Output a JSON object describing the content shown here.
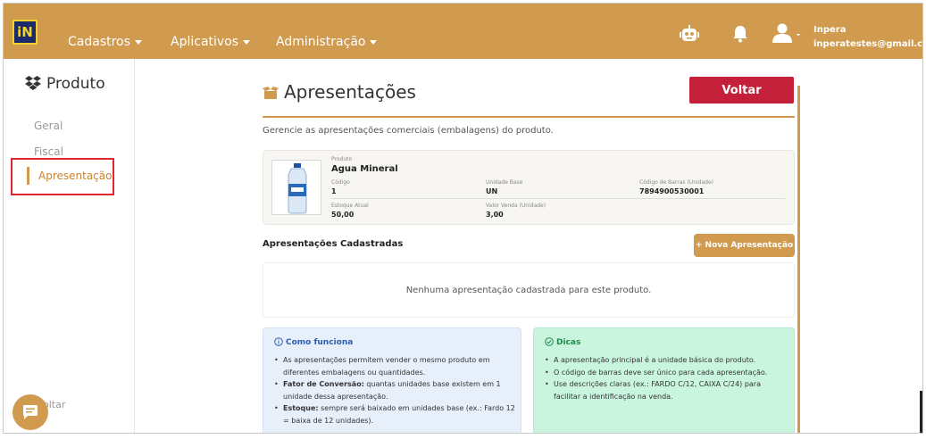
{
  "app": {
    "logo_text": "iN"
  },
  "nav": {
    "items": [
      {
        "label": "Cadastros"
      },
      {
        "label": "Aplicativos"
      },
      {
        "label": "Administração"
      }
    ]
  },
  "user": {
    "name": "Inpera",
    "email": "inperatestes@gmail.com"
  },
  "sidebar": {
    "title": "Produto",
    "items": [
      {
        "label": "Geral"
      },
      {
        "label": "Fiscal"
      },
      {
        "label": "Apresentação"
      }
    ],
    "bottom_label": "oltar"
  },
  "main": {
    "title": "Apresentações",
    "back_button": "Voltar",
    "subtitle": "Gerencie as apresentações comerciais (embalagens) do produto.",
    "product": {
      "label_produto": "Produto",
      "nome": "Agua Mineral",
      "label_codigo": "Código",
      "codigo": "1",
      "label_unidade": "Unidade Base",
      "unidade": "UN",
      "label_barras": "Código de Barras (Unidade)",
      "barras": "7894900530001",
      "label_estoque": "Estoque Atual",
      "estoque": "50,00",
      "label_valor": "Valor Venda (Unidade)",
      "valor": "3,00"
    },
    "section_title": "Apresentações Cadastradas",
    "new_button": "+ Nova Apresentação",
    "empty_text": "Nenhuma apresentação cadastrada para este produto.",
    "info": {
      "title": "Como funciona",
      "items": [
        {
          "bold": "",
          "text": "As apresentações permitem vender o mesmo produto em diferentes embalagens ou quantidades."
        },
        {
          "bold": "Fator de Conversão:",
          "text": " quantas unidades base existem em 1 unidade dessa apresentação."
        },
        {
          "bold": "Estoque:",
          "text": " sempre será baixado em unidades base (ex.: Fardo 12 = baixa de 12 unidades)."
        }
      ]
    },
    "tips": {
      "title": "Dicas",
      "items": [
        {
          "text": "A apresentação principal é a unidade básica do produto."
        },
        {
          "text": "O código de barras deve ser único para cada apresentação."
        },
        {
          "text": "Use descrições claras (ex.: FARDO C/12, CAIXA C/24) para facilitar a identificação na venda."
        }
      ]
    }
  },
  "colors": {
    "brand": "#d09a4f",
    "danger": "#c4203a",
    "info_bg": "#e7effb",
    "tips_bg": "#c9f5df"
  },
  "icons": {
    "logo": "inpera-logo",
    "robot": "robot-icon",
    "bell": "bell-icon",
    "user": "user-icon",
    "dropbox": "boxes-icon",
    "box": "box-icon",
    "info": "info-circle-icon",
    "check": "check-circle-icon",
    "chat": "chat-icon"
  }
}
